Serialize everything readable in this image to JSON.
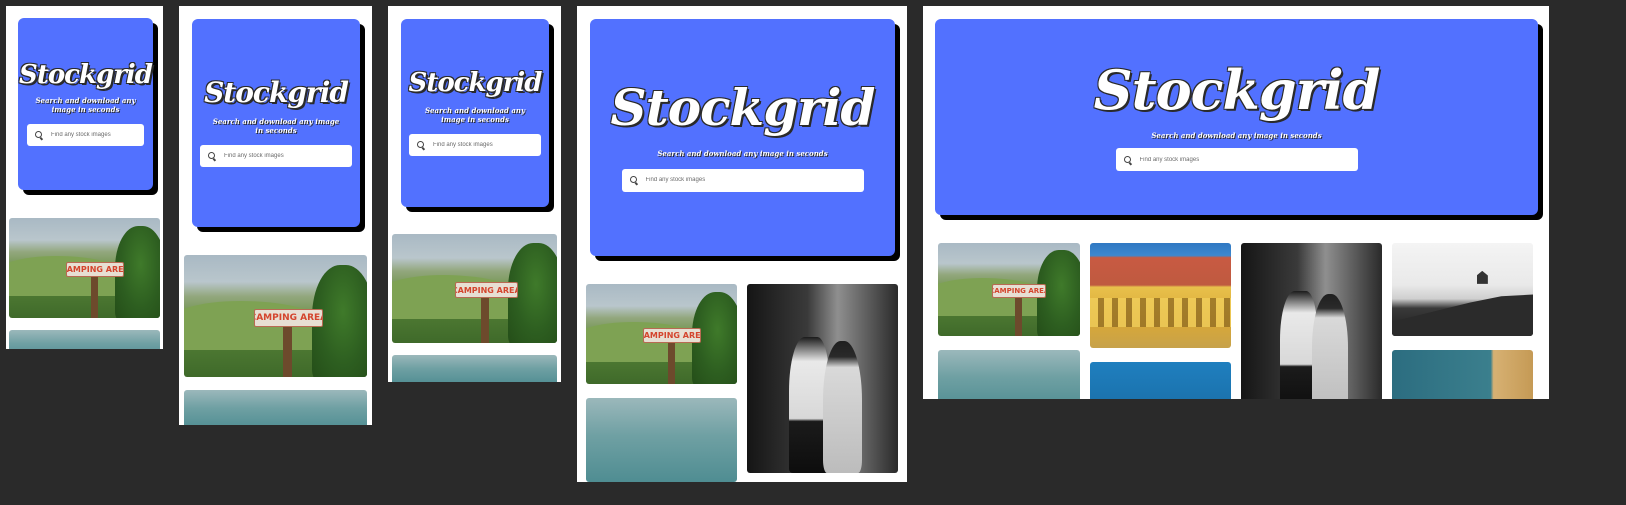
{
  "app": {
    "logo": "Stockgrid",
    "tagline": "Search and download any image in seconds",
    "search_placeholder": "Find any stock images"
  },
  "views": [
    {
      "name": "mobile-small"
    },
    {
      "name": "mobile-medium"
    },
    {
      "name": "mobile-large"
    },
    {
      "name": "tablet"
    },
    {
      "name": "desktop"
    }
  ],
  "images": {
    "camping_sign": "CAMPING AREA"
  },
  "colors": {
    "hero_bg": "#5271ff",
    "page_bg": "#2a2a2a",
    "frame_bg": "#ffffff",
    "shadow": "#000000"
  }
}
